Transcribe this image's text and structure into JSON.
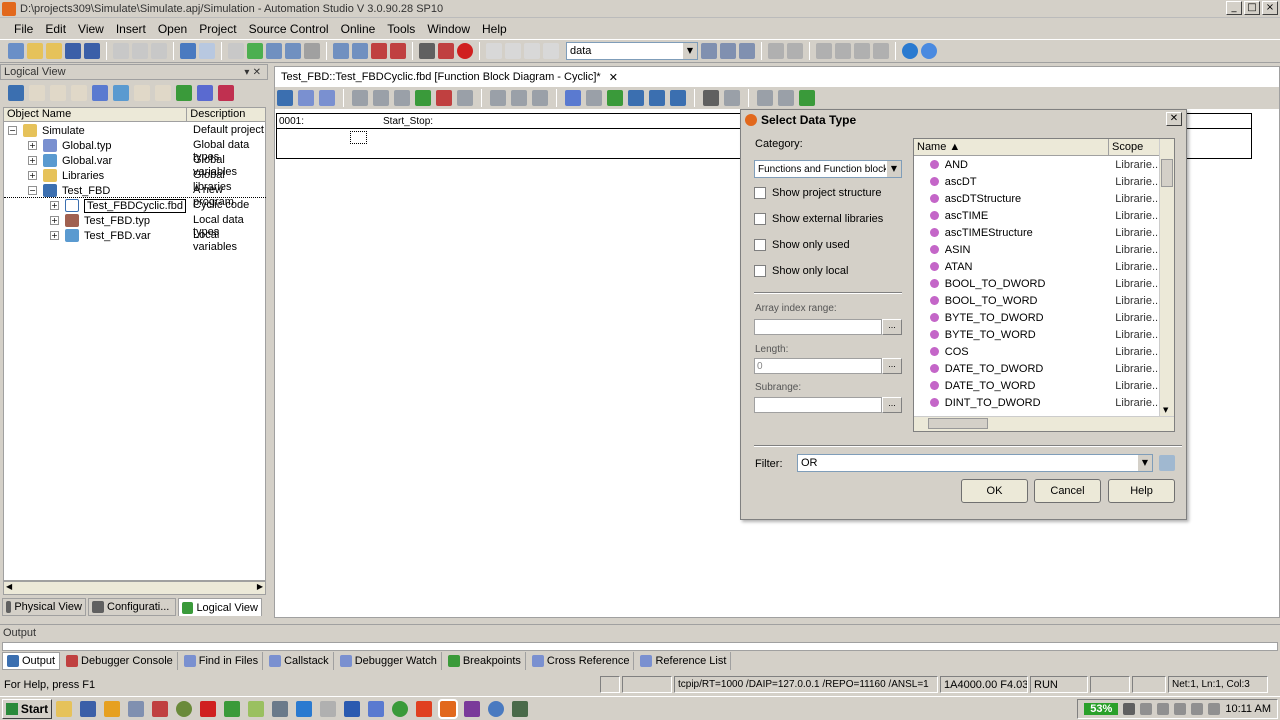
{
  "window": {
    "title": "D:\\projects309\\Simulate\\Simulate.apj/Simulation - Automation Studio V 3.0.90.28 SP10"
  },
  "menu": [
    "File",
    "Edit",
    "View",
    "Insert",
    "Open",
    "Project",
    "Source Control",
    "Online",
    "Tools",
    "Window",
    "Help"
  ],
  "toolbar": {
    "search_combo": "data"
  },
  "logical_view": {
    "title": "Logical View",
    "columns": [
      "Object Name",
      "Description"
    ],
    "rows": [
      {
        "name": "Simulate",
        "desc": "Default project",
        "expander": "−"
      },
      {
        "name": "Global.typ",
        "desc": "Global data types",
        "expander": "+"
      },
      {
        "name": "Global.var",
        "desc": "Global variables",
        "expander": "+"
      },
      {
        "name": "Libraries",
        "desc": "Global libraries",
        "expander": "+"
      },
      {
        "name": "Test_FBD",
        "desc": "A new program",
        "expander": "−"
      },
      {
        "name": "Test_FBDCyclic.fbd",
        "desc": "Cyclic code",
        "expander": "+"
      },
      {
        "name": "Test_FBD.typ",
        "desc": "Local data types",
        "expander": "+"
      },
      {
        "name": "Test_FBD.var",
        "desc": "Local variables",
        "expander": "+"
      }
    ],
    "tabs": [
      "Physical View",
      "Configurati...",
      "Logical View"
    ]
  },
  "editor": {
    "tab_title": "Test_FBD::Test_FBDCyclic.fbd [Function Block Diagram - Cyclic]*",
    "network_no": "0001:",
    "network_label": "Start_Stop:"
  },
  "dialog": {
    "title": "Select Data Type",
    "category_label": "Category:",
    "category_value": "Functions and Function block",
    "checkboxes": [
      "Show project structure",
      "Show external libraries",
      "Show only used",
      "Show only local"
    ],
    "array_label": "Array index range:",
    "length_label": "Length:",
    "length_value": "0",
    "subrange_label": "Subrange:",
    "dots": "...",
    "list_columns": [
      "Name ▲",
      "Scope"
    ],
    "items": [
      {
        "name": "AND",
        "scope": "Librarie..."
      },
      {
        "name": "ascDT",
        "scope": "Librarie..."
      },
      {
        "name": "ascDTStructure",
        "scope": "Librarie..."
      },
      {
        "name": "ascTIME",
        "scope": "Librarie..."
      },
      {
        "name": "ascTIMEStructure",
        "scope": "Librarie..."
      },
      {
        "name": "ASIN",
        "scope": "Librarie..."
      },
      {
        "name": "ATAN",
        "scope": "Librarie..."
      },
      {
        "name": "BOOL_TO_DWORD",
        "scope": "Librarie..."
      },
      {
        "name": "BOOL_TO_WORD",
        "scope": "Librarie..."
      },
      {
        "name": "BYTE_TO_DWORD",
        "scope": "Librarie..."
      },
      {
        "name": "BYTE_TO_WORD",
        "scope": "Librarie..."
      },
      {
        "name": "COS",
        "scope": "Librarie..."
      },
      {
        "name": "DATE_TO_DWORD",
        "scope": "Librarie..."
      },
      {
        "name": "DATE_TO_WORD",
        "scope": "Librarie..."
      },
      {
        "name": "DINT_TO_DWORD",
        "scope": "Librarie..."
      }
    ],
    "filter_label": "Filter:",
    "filter_value": "OR",
    "ok": "OK",
    "cancel": "Cancel",
    "help": "Help"
  },
  "output": {
    "title": "Output",
    "tabs": [
      "Output",
      "Debugger Console",
      "Find in Files",
      "Callstack",
      "Debugger Watch",
      "Breakpoints",
      "Cross Reference",
      "Reference List"
    ]
  },
  "statusbar": {
    "help": "For Help, press F1",
    "conn": "tcpip/RT=1000 /DAIP=127.0.0.1 /REPO=11160 /ANSL=1",
    "target": "1A4000.00  F4.03",
    "mode": "RUN",
    "pos": "Net:1, Ln:1, Col:3"
  },
  "taskbar": {
    "start": "Start",
    "battery": "53%",
    "clock": "10:11 AM"
  },
  "colors": {
    "dialog_icon": "#e2681c",
    "function_icon": "#c466c8"
  }
}
